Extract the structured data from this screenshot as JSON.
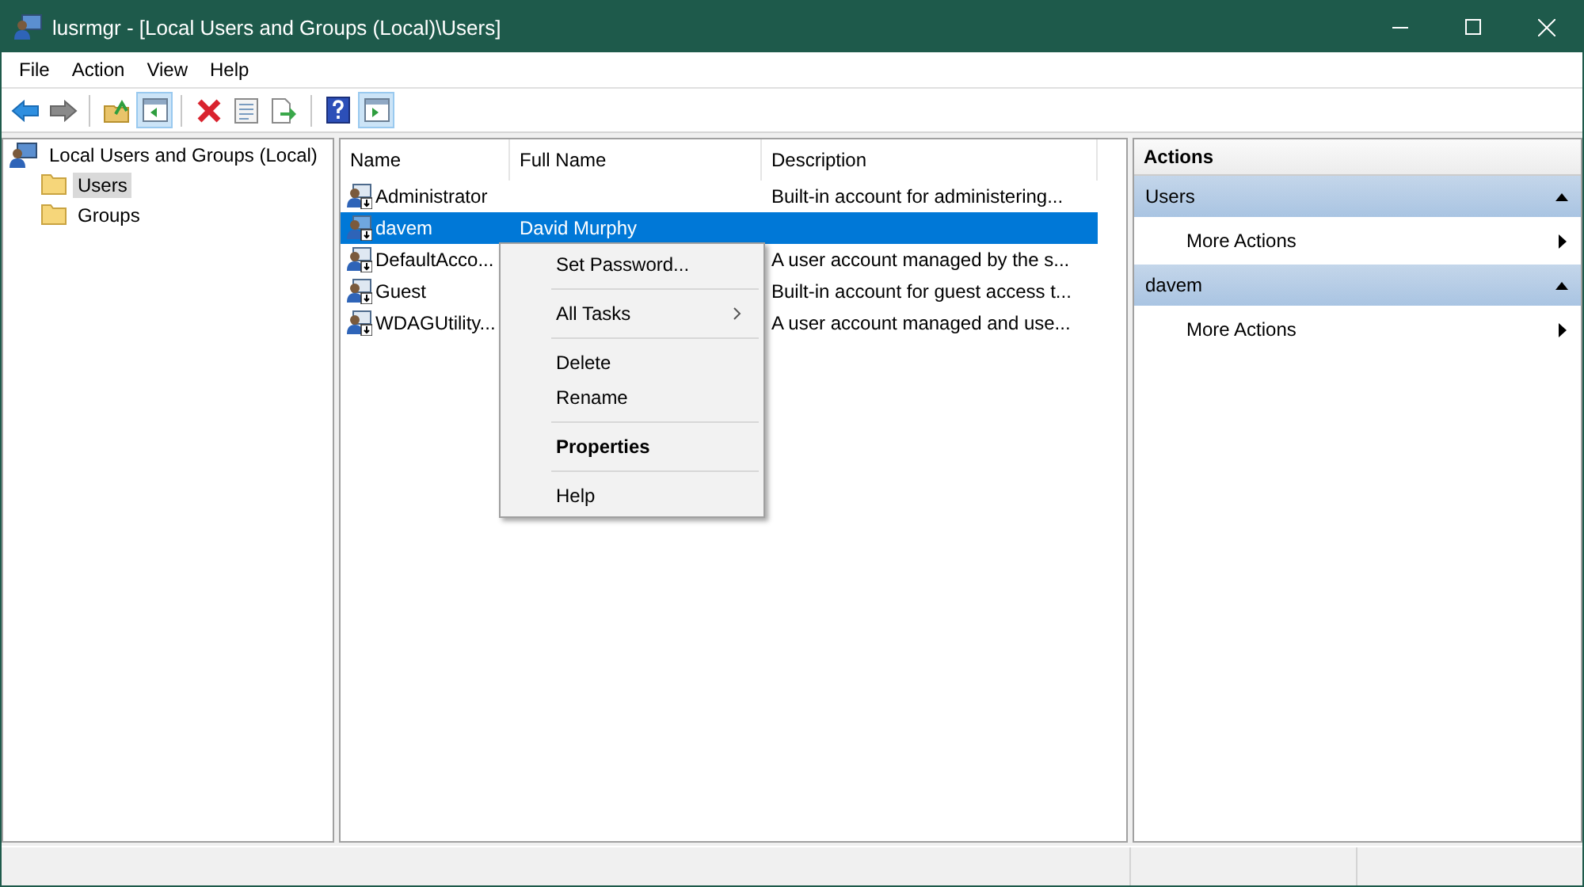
{
  "window": {
    "title": "lusrmgr - [Local Users and Groups (Local)\\Users]"
  },
  "menu_bar": [
    "File",
    "Action",
    "View",
    "Help"
  ],
  "toolbar": [
    [
      {
        "kind": "back",
        "pressed": false
      },
      {
        "kind": "forward",
        "pressed": false
      }
    ],
    [
      {
        "kind": "up",
        "pressed": false
      },
      {
        "kind": "tree",
        "pressed": true
      }
    ],
    [
      {
        "kind": "delete",
        "pressed": false
      },
      {
        "kind": "properties",
        "pressed": false
      },
      {
        "kind": "export",
        "pressed": false
      }
    ],
    [
      {
        "kind": "help",
        "pressed": false
      },
      {
        "kind": "action_pane",
        "pressed": true
      }
    ]
  ],
  "tree": {
    "label": "Local Users and Groups (Local)",
    "children": [
      {
        "label": "Users",
        "selected": true
      },
      {
        "label": "Groups",
        "selected": false
      }
    ]
  },
  "table": {
    "columns": [
      "Name",
      "Full Name",
      "Description"
    ],
    "rows": [
      {
        "name": "Administrator",
        "full_name": "",
        "description": "Built-in account for administering...",
        "selected": false
      },
      {
        "name": "davem",
        "full_name": "David Murphy",
        "description": "",
        "selected": true
      },
      {
        "name": "DefaultAcco...",
        "full_name": "",
        "description": "A user account managed by the s...",
        "selected": false
      },
      {
        "name": "Guest",
        "full_name": "",
        "description": "Built-in account for guest access t...",
        "selected": false
      },
      {
        "name": "WDAGUtility...",
        "full_name": "",
        "description": "A user account managed and use...",
        "selected": false
      }
    ]
  },
  "context_menu": [
    [
      {
        "label": "Set Password...",
        "bold": false,
        "submenu": false
      }
    ],
    [
      {
        "label": "All Tasks",
        "bold": false,
        "submenu": true
      }
    ],
    [
      {
        "label": "Delete",
        "bold": false,
        "submenu": false
      },
      {
        "label": "Rename",
        "bold": false,
        "submenu": false
      }
    ],
    [
      {
        "label": "Properties",
        "bold": true,
        "submenu": false
      }
    ],
    [
      {
        "label": "Help",
        "bold": false,
        "submenu": false
      }
    ]
  ],
  "actions": {
    "title": "Actions",
    "sections": [
      {
        "title": "Users",
        "expanded": true,
        "items": [
          "More Actions"
        ]
      },
      {
        "title": "davem",
        "expanded": true,
        "items": [
          "More Actions"
        ]
      }
    ]
  }
}
